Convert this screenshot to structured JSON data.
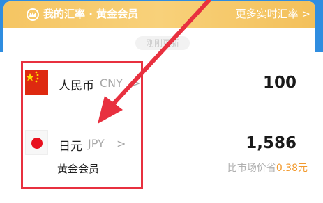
{
  "header": {
    "title": "我的汇率 · 黄金会员",
    "more_link": "更多实时汇率 >"
  },
  "update_badge": "刚刚更新",
  "rows": [
    {
      "currency_name": "人民币",
      "currency_code": "CNY",
      "chevron": ">",
      "amount": "100",
      "flag_icon": "china-flag-icon"
    },
    {
      "currency_name": "日元",
      "currency_code": "JPY",
      "chevron": ">",
      "amount": "1,586",
      "flag_icon": "japan-flag-icon"
    }
  ],
  "member": {
    "label": "黄金会员",
    "saving_prefix": "比市场价省",
    "saving_value": "0.38元"
  },
  "colors": {
    "header_gold": "#f5c563",
    "accent_orange": "#f29a2e",
    "annotation_red": "#e8303f",
    "top_blue": "#2f8de0"
  }
}
